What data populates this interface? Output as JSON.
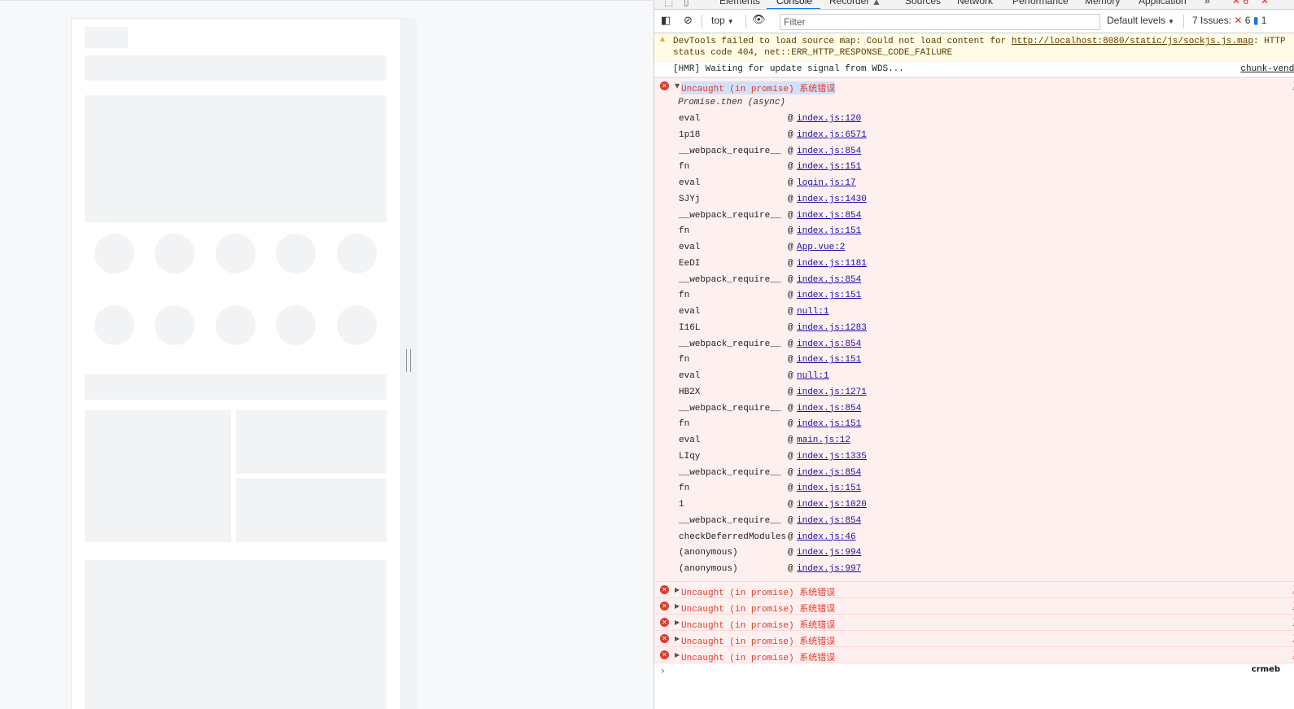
{
  "devtools": {
    "tabs": [
      "Elements",
      "Console",
      "Recorder",
      "Sources",
      "Network",
      "Performance",
      "Memory",
      "Application"
    ],
    "active_tab": "Console",
    "more_tabs": "»",
    "error_count_badge": "6"
  },
  "toolbar": {
    "context": "top",
    "filter_placeholder": "Filter",
    "levels": "Default levels",
    "issues_label": "7 Issues:",
    "issues_errors": "6",
    "issues_info": "1"
  },
  "console": {
    "warning": {
      "line1_prefix": "DevTools failed to load source map: Could not load content for ",
      "url": "http://localhost:8080/static/js/sockjs.js.map",
      "line1_suffix": ": HTTP",
      "line2": "status code 404, net::ERR_HTTP_RESPONSE_CODE_FAILURE"
    },
    "log": {
      "message": "[HMR] Waiting for update signal from WDS...",
      "source": "chunk-vendo"
    },
    "error": {
      "message": "Uncaught (in promise) 系统错误",
      "async": "Promise.then (async)",
      "frames": [
        {
          "fn": "eval",
          "loc": "index.js:120"
        },
        {
          "fn": "1p18",
          "loc": "index.js:6571"
        },
        {
          "fn": "__webpack_require__",
          "loc": "index.js:854"
        },
        {
          "fn": "fn",
          "loc": "index.js:151"
        },
        {
          "fn": "eval",
          "loc": "login.js:17"
        },
        {
          "fn": "SJYj",
          "loc": "index.js:1430"
        },
        {
          "fn": "__webpack_require__",
          "loc": "index.js:854"
        },
        {
          "fn": "fn",
          "loc": "index.js:151"
        },
        {
          "fn": "eval",
          "loc": "App.vue:2"
        },
        {
          "fn": "EeDI",
          "loc": "index.js:1181"
        },
        {
          "fn": "__webpack_require__",
          "loc": "index.js:854"
        },
        {
          "fn": "fn",
          "loc": "index.js:151"
        },
        {
          "fn": "eval",
          "loc": "null:1"
        },
        {
          "fn": "I16L",
          "loc": "index.js:1283"
        },
        {
          "fn": "__webpack_require__",
          "loc": "index.js:854"
        },
        {
          "fn": "fn",
          "loc": "index.js:151"
        },
        {
          "fn": "eval",
          "loc": "null:1"
        },
        {
          "fn": "HB2X",
          "loc": "index.js:1271"
        },
        {
          "fn": "__webpack_require__",
          "loc": "index.js:854"
        },
        {
          "fn": "fn",
          "loc": "index.js:151"
        },
        {
          "fn": "eval",
          "loc": "main.js:12"
        },
        {
          "fn": "LIqy",
          "loc": "index.js:1335"
        },
        {
          "fn": "__webpack_require__",
          "loc": "index.js:854"
        },
        {
          "fn": "fn",
          "loc": "index.js:151"
        },
        {
          "fn": "1",
          "loc": "index.js:1020"
        },
        {
          "fn": "__webpack_require__",
          "loc": "index.js:854"
        },
        {
          "fn": "checkDeferredModules",
          "loc": "index.js:46"
        },
        {
          "fn": "(anonymous)",
          "loc": "index.js:994"
        },
        {
          "fn": "(anonymous)",
          "loc": "index.js:997"
        }
      ]
    },
    "collapsed_errors": [
      "Uncaught (in promise) 系统错误",
      "Uncaught (in promise) 系统错误",
      "Uncaught (in promise) 系统错误",
      "Uncaught (in promise) 系统错误",
      "Uncaught (in promise) 系统错误"
    ],
    "prompt": "›",
    "watermark": "crmeb"
  }
}
